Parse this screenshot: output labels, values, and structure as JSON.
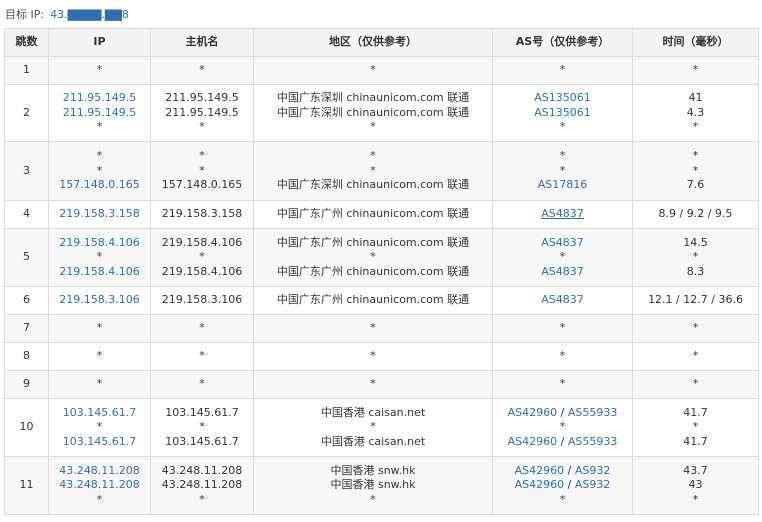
{
  "target": {
    "label": "目标 IP:",
    "value": "43.▇▇▇▇.▇▇8"
  },
  "columns": [
    "跳数",
    "IP",
    "主机名",
    "地区（仅供参考）",
    "AS号（仅供参考）",
    "时间（毫秒）"
  ],
  "hops": [
    {
      "num": "1",
      "h": 28,
      "rows": [
        {
          "ip": "*",
          "host": "*",
          "region": "*",
          "as": [
            "*"
          ],
          "time": "*"
        }
      ]
    },
    {
      "num": "2",
      "h": 57,
      "rows": [
        {
          "ip": "211.95.149.5",
          "host": "211.95.149.5",
          "region": "中国广东深圳 chinaunicom.com 联通",
          "as": [
            "AS135061"
          ],
          "time": "41"
        },
        {
          "ip": "211.95.149.5",
          "host": "211.95.149.5",
          "region": "中国广东深圳 chinaunicom.com 联通",
          "as": [
            "AS135061"
          ],
          "time": "4.3"
        },
        {
          "ip": "*",
          "host": "*",
          "region": "*",
          "as": [
            "*"
          ],
          "time": "*"
        }
      ]
    },
    {
      "num": "3",
      "h": 59,
      "rows": [
        {
          "ip": "*",
          "host": "*",
          "region": "*",
          "as": [
            "*"
          ],
          "time": "*"
        },
        {
          "ip": "*",
          "host": "*",
          "region": "*",
          "as": [
            "*"
          ],
          "time": "*"
        },
        {
          "ip": "157.148.0.165",
          "host": "157.148.0.165",
          "region": "中国广东深圳 chinaunicom.com 联通",
          "as": [
            "AS17816"
          ],
          "time": "7.6"
        }
      ]
    },
    {
      "num": "4",
      "h": 28,
      "rows": [
        {
          "ip": "219.158.3.158",
          "host": "219.158.3.158",
          "region": "中国广东广州 chinaunicom.com 联通",
          "as": [
            "AS4837"
          ],
          "asUnderline": true,
          "time": "8.9 / 9.2 / 9.5"
        }
      ]
    },
    {
      "num": "5",
      "h": 58,
      "rows": [
        {
          "ip": "219.158.4.106",
          "host": "219.158.4.106",
          "region": "中国广东广州 chinaunicom.com 联通",
          "as": [
            "AS4837"
          ],
          "time": "14.5"
        },
        {
          "ip": "*",
          "host": "*",
          "region": "*",
          "as": [
            "*"
          ],
          "time": "*"
        },
        {
          "ip": "219.158.4.106",
          "host": "219.158.4.106",
          "region": "中国广东广州 chinaunicom.com 联通",
          "as": [
            "AS4837"
          ],
          "time": "8.3"
        }
      ]
    },
    {
      "num": "6",
      "h": 28,
      "rows": [
        {
          "ip": "219.158.3.106",
          "host": "219.158.3.106",
          "region": "中国广东广州 chinaunicom.com 联通",
          "as": [
            "AS4837"
          ],
          "time": "12.1 / 12.7 / 36.6"
        }
      ]
    },
    {
      "num": "7",
      "h": 28,
      "rows": [
        {
          "ip": "*",
          "host": "*",
          "region": "*",
          "as": [
            "*"
          ],
          "time": "*"
        }
      ]
    },
    {
      "num": "8",
      "h": 28,
      "rows": [
        {
          "ip": "*",
          "host": "*",
          "region": "*",
          "as": [
            "*"
          ],
          "time": "*"
        }
      ]
    },
    {
      "num": "9",
      "h": 28,
      "rows": [
        {
          "ip": "*",
          "host": "*",
          "region": "*",
          "as": [
            "*"
          ],
          "time": "*"
        }
      ]
    },
    {
      "num": "10",
      "h": 58,
      "rows": [
        {
          "ip": "103.145.61.7",
          "host": "103.145.61.7",
          "region": "中国香港 caisan.net",
          "as": [
            "AS42960",
            "AS55933"
          ],
          "time": "41.7"
        },
        {
          "ip": "*",
          "host": "*",
          "region": "*",
          "as": [
            "*"
          ],
          "time": "*"
        },
        {
          "ip": "103.145.61.7",
          "host": "103.145.61.7",
          "region": "中国香港 caisan.net",
          "as": [
            "AS42960",
            "AS55933"
          ],
          "time": "41.7"
        }
      ]
    },
    {
      "num": "11",
      "h": 58,
      "rows": [
        {
          "ip": "43.248.11.208",
          "host": "43.248.11.208",
          "region": "中国香港 snw.hk",
          "as": [
            "AS42960",
            "AS932"
          ],
          "time": "43.7"
        },
        {
          "ip": "43.248.11.208",
          "host": "43.248.11.208",
          "region": "中国香港 snw.hk",
          "as": [
            "AS42960",
            "AS932"
          ],
          "time": "43"
        },
        {
          "ip": "*",
          "host": "*",
          "region": "*",
          "as": [
            "*"
          ],
          "time": "*"
        }
      ]
    }
  ]
}
